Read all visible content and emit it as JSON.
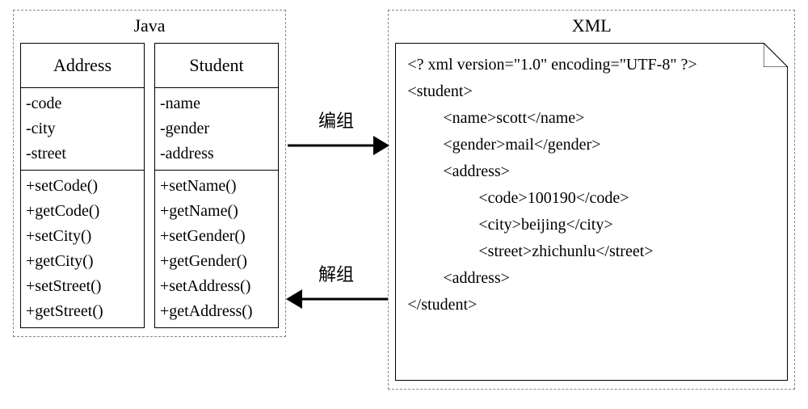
{
  "java": {
    "title": "Java",
    "classes": {
      "address": {
        "name": "Address",
        "attrs": [
          "-code",
          "-city",
          "-street"
        ],
        "ops": [
          "+setCode()",
          "+getCode()",
          "+setCity()",
          "+getCity()",
          "+setStreet()",
          "+getStreet()"
        ]
      },
      "student": {
        "name": "Student",
        "attrs": [
          "-name",
          "-gender",
          "-address"
        ],
        "ops": [
          "+setName()",
          "+getName()",
          "+setGender()",
          "+getGender()",
          "+setAddress()",
          "+getAddress()"
        ]
      }
    }
  },
  "arrows": {
    "marshal": "编组",
    "unmarshal": "解组"
  },
  "xml": {
    "title": "XML",
    "lines": {
      "decl": "<? xml version=\"1.0\" encoding=\"UTF-8\" ?>",
      "root_open": "<student>",
      "name": "<name>scott</name>",
      "gender": "<gender>mail</gender>",
      "addr_open": "<address>",
      "code": "<code>100190</code>",
      "city": "<city>beijing</city>",
      "street": "<street>zhichunlu</street>",
      "addr_close": "<address>",
      "root_close": "</student>"
    }
  },
  "chart_data": {
    "type": "diagram",
    "description": "Mapping between Java classes (Address, Student) and an XML document. Arrow right labeled 编组 (marshal) from Java to XML; arrow left labeled 解组 (unmarshal) from XML back to Java.",
    "java_classes": [
      {
        "name": "Address",
        "attributes": [
          "code",
          "city",
          "street"
        ],
        "operations": [
          "setCode()",
          "getCode()",
          "setCity()",
          "getCity()",
          "setStreet()",
          "getStreet()"
        ]
      },
      {
        "name": "Student",
        "attributes": [
          "name",
          "gender",
          "address"
        ],
        "operations": [
          "setName()",
          "getName()",
          "setGender()",
          "getGender()",
          "setAddress()",
          "getAddress()"
        ]
      }
    ],
    "xml_instance": {
      "student": {
        "name": "scott",
        "gender": "mail",
        "address": {
          "code": "100190",
          "city": "beijing",
          "street": "zhichunlu"
        }
      }
    },
    "relations": [
      {
        "from": "Java",
        "to": "XML",
        "label": "编组"
      },
      {
        "from": "XML",
        "to": "Java",
        "label": "解组"
      }
    ]
  }
}
